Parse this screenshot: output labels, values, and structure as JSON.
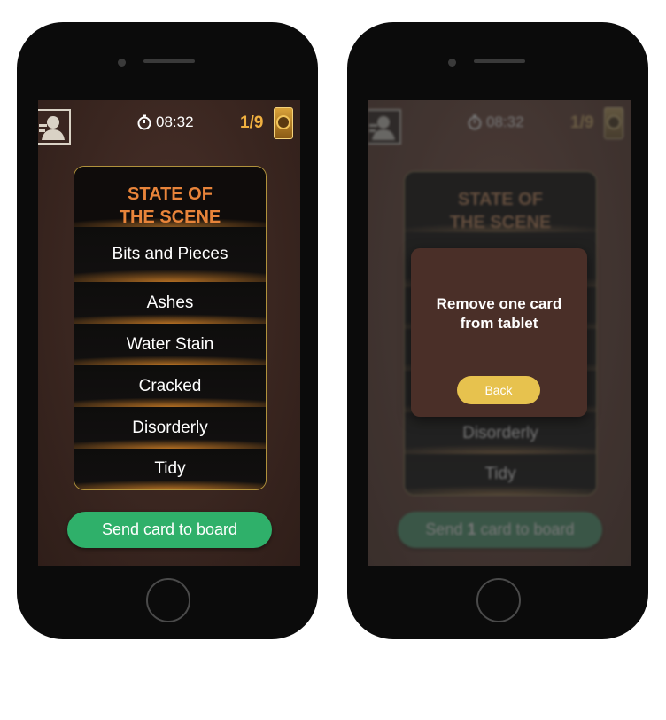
{
  "left_phone": {
    "timer": "08:32",
    "counter": "1/9",
    "card": {
      "title_line1": "STATE OF",
      "title_line2": "THE SCENE",
      "options": [
        "Bits and Pieces",
        "Ashes",
        "Water Stain",
        "Cracked",
        "Disorderly",
        "Tidy"
      ]
    },
    "send_button": "Send card to board"
  },
  "right_phone": {
    "timer": "08:32",
    "counter": "1/9",
    "card": {
      "title_line1": "STATE OF",
      "title_line2": "THE SCENE",
      "options": [
        "Disorderly",
        "Tidy"
      ]
    },
    "send_button_prefix": "Send ",
    "send_button_count": "1",
    "send_button_suffix": " card to board",
    "modal": {
      "message": "Remove one card from tablet",
      "back_button": "Back"
    }
  },
  "colors": {
    "accent_green": "#2fb06a",
    "title_orange": "#e8843a",
    "counter_gold": "#f0b040",
    "back_yellow": "#e7c24e"
  },
  "icons": [
    "user-avatar-icon",
    "stopwatch-icon",
    "card-deck-icon"
  ]
}
